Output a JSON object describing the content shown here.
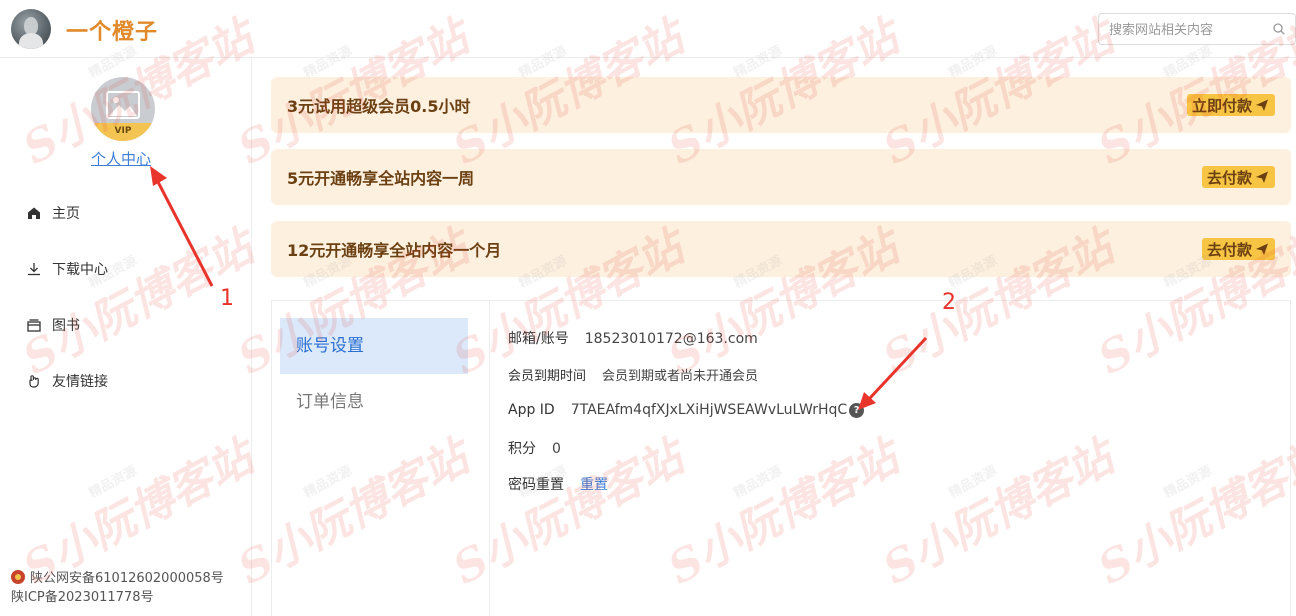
{
  "header": {
    "site_title": "一个橙子",
    "search_placeholder": "搜索网站相关内容"
  },
  "sidebar": {
    "vip_badge": "VIP",
    "profile_link": "个人中心",
    "nav": [
      {
        "label": "主页",
        "icon": "home-icon"
      },
      {
        "label": "下载中心",
        "icon": "download-icon"
      },
      {
        "label": "图书",
        "icon": "book-icon"
      },
      {
        "label": "友情链接",
        "icon": "link-icon"
      }
    ],
    "footer": {
      "police_record": "陕公网安备61012602000058号",
      "icp_record": "陕ICP备2023011778号"
    }
  },
  "plans": [
    {
      "title": "3元试用超级会员0.5小时",
      "button": "立即付款"
    },
    {
      "title": "5元开通畅享全站内容一周",
      "button": "去付款"
    },
    {
      "title": "12元开通畅享全站内容一个月",
      "button": "去付款"
    }
  ],
  "settings": {
    "tabs": [
      {
        "label": "账号设置",
        "active": true
      },
      {
        "label": "订单信息",
        "active": false
      }
    ],
    "rows": {
      "email_label": "邮箱/账号",
      "email_value": "18523010172@163.com",
      "expiry_label": "会员到期时间",
      "expiry_value": "会员到期或者尚未开通会员",
      "appid_label": "App ID",
      "appid_value": "7TAEAfm4qfXJxLXiHjWSEAWvLuLWrHqC",
      "points_label": "积分",
      "points_value": "0",
      "password_label": "密码重置",
      "password_action": "重置"
    }
  },
  "annotations": {
    "marker_1": "1",
    "marker_2": "2",
    "color": "#e8342b"
  },
  "watermark": {
    "big": "S小阮博客站",
    "small": "精品资源"
  },
  "colors": {
    "brand": "#e08a2c",
    "plan_bg": "#fdf0df",
    "plan_button": "#f7c543",
    "link": "#3e7fd6",
    "active_tab_bg": "#dce9fb"
  }
}
